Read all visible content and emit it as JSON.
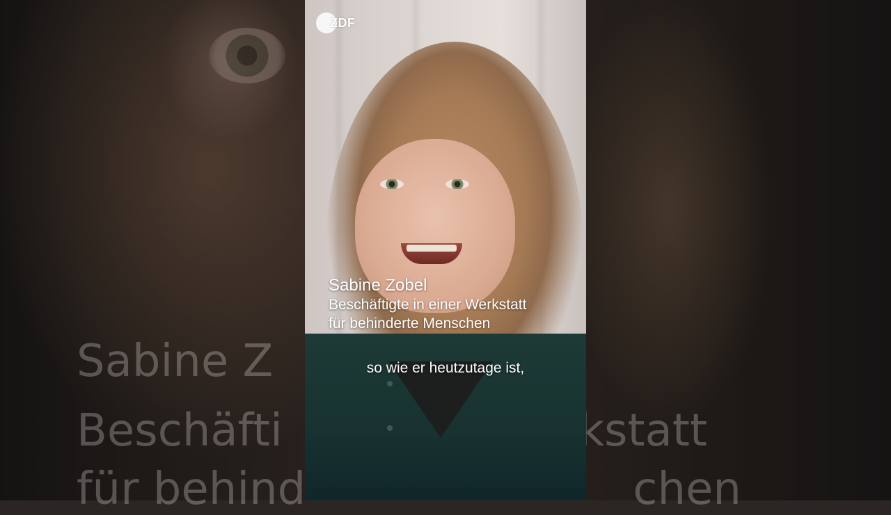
{
  "logo": {
    "text": "ZDF"
  },
  "lower_third": {
    "name": "Sabine Zobel",
    "role_line1": "Beschäftigte in einer Werkstatt",
    "role_line2": "für behinderte Menschen"
  },
  "subtitle": {
    "text": "so wie er heutzutage ist,"
  },
  "background_echo": {
    "name": "Sabine Z",
    "role_left": "Beschäfti",
    "role_right": "Werkstatt",
    "role2_left": "für behind",
    "role2_right": "chen"
  },
  "colors": {
    "shirt": "#173230",
    "hair": "#a57a55",
    "curtain": "#ddd6d2",
    "text": "#ffffff"
  }
}
